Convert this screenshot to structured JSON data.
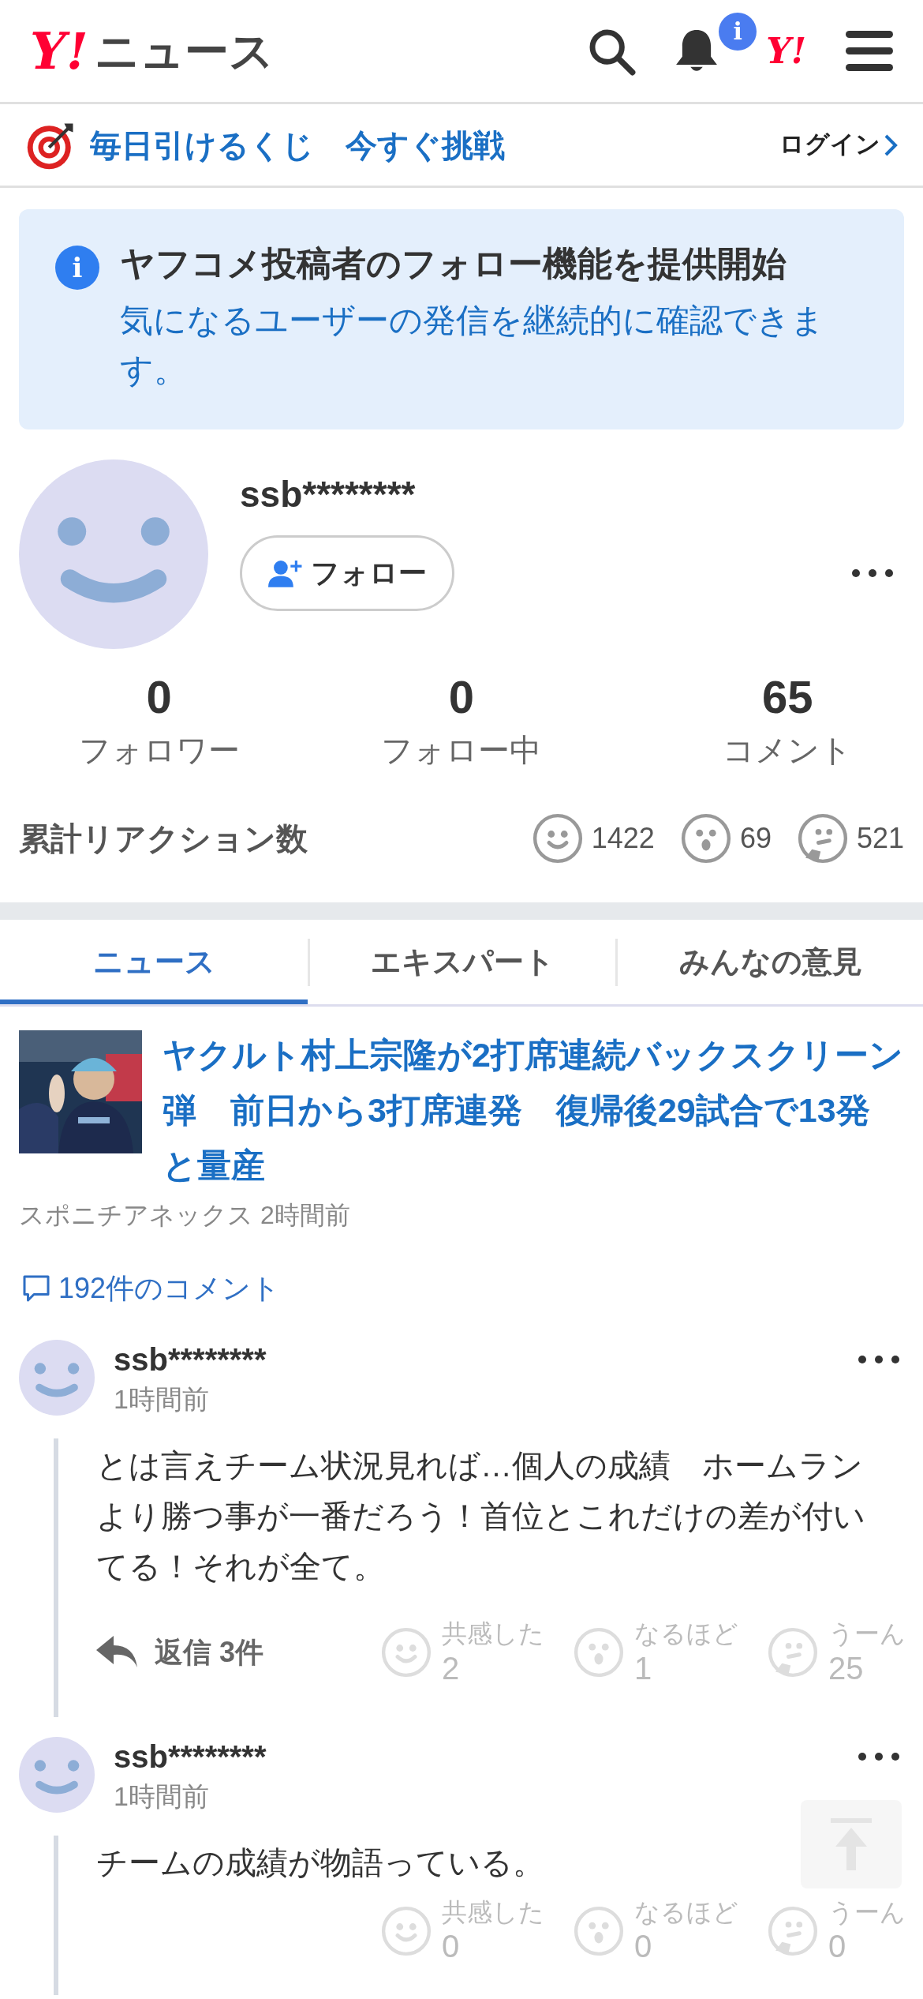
{
  "header": {
    "logo_mark": "Y!",
    "title": "ニュース",
    "notification_badge": "i",
    "yahoo_mark": "Y!"
  },
  "promo": {
    "text": "毎日引けるくじ　今すぐ挑戦",
    "login": "ログイン"
  },
  "notice": {
    "icon": "i",
    "title": "ヤフコメ投稿者のフォロー機能を提供開始",
    "body": "気になるユーザーの発信を継続的に確認できます。"
  },
  "profile": {
    "name": "ssb********",
    "follow_button": "フォロー",
    "stats": [
      {
        "value": "0",
        "label": "フォロワー"
      },
      {
        "value": "0",
        "label": "フォロー中"
      },
      {
        "value": "65",
        "label": "コメント"
      }
    ],
    "reactions_label": "累計リアクション数",
    "reactions": [
      {
        "kind": "smile",
        "count": "1422"
      },
      {
        "kind": "surprised",
        "count": "69"
      },
      {
        "kind": "thinking",
        "count": "521"
      }
    ]
  },
  "tabs": [
    {
      "label": "ニュース",
      "selected": true
    },
    {
      "label": "エキスパート",
      "selected": false
    },
    {
      "label": "みんなの意見",
      "selected": false
    }
  ],
  "article": {
    "title": "ヤクルト村上宗隆が2打席連続バックスクリーン弾　前日から3打席連発　復帰後29試合で13発と量産",
    "source": "スポニチアネックス 2時間前",
    "comments_link": "192件のコメント"
  },
  "comments": [
    {
      "user": "ssb********",
      "time": "1時間前",
      "text": "とは言えチーム状況見れば…個人の成績　ホームランより勝つ事が一番だろう！首位とこれだけの差が付いてる！それが全て。",
      "replies": "返信 3件",
      "reactions": [
        {
          "kind": "smile",
          "label": "共感した",
          "count": "2"
        },
        {
          "kind": "surprised",
          "label": "なるほど",
          "count": "1"
        },
        {
          "kind": "thinking",
          "label": "うーん",
          "count": "25"
        }
      ]
    },
    {
      "user": "ssb********",
      "time": "1時間前",
      "text": "チームの成績が物語っている。",
      "reactions": [
        {
          "kind": "smile",
          "label": "共感した",
          "count": "0"
        },
        {
          "kind": "surprised",
          "label": "なるほど",
          "count": "0"
        },
        {
          "kind": "thinking",
          "label": "うーん",
          "count": "0"
        }
      ]
    }
  ]
}
